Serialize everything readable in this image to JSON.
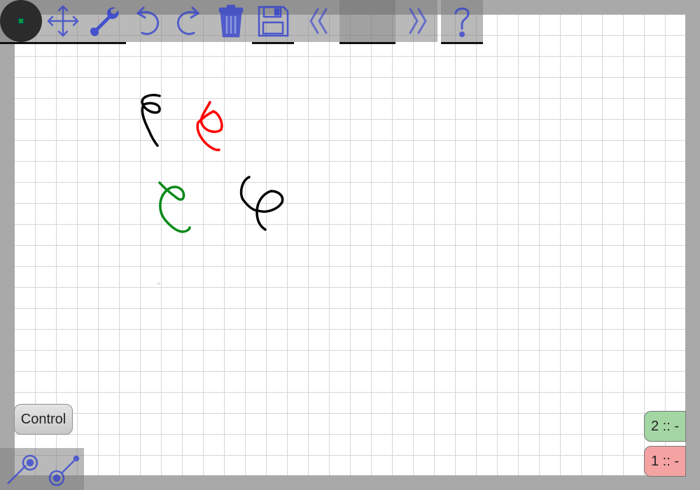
{
  "toolbar": {
    "current_color": "#0a9a3a",
    "tools": [
      {
        "name": "move-icon"
      },
      {
        "name": "wrench-icon"
      },
      {
        "name": "undo-icon"
      },
      {
        "name": "redo-icon"
      },
      {
        "name": "trash-icon"
      },
      {
        "name": "save-icon"
      },
      {
        "name": "previous-page-icon"
      },
      {
        "name": "next-page-icon"
      },
      {
        "name": "help-icon"
      }
    ],
    "page_indicator": ""
  },
  "control_button": {
    "label": "Control"
  },
  "players": [
    {
      "label": "2 :: -",
      "color": "#a4d6a4"
    },
    {
      "label": "1 :: -",
      "color": "#f4a2a2"
    }
  ],
  "bottom_tools": [
    {
      "name": "line-tool-a-icon"
    },
    {
      "name": "line-tool-b-icon"
    }
  ],
  "strokes": [
    {
      "color": "#000000"
    },
    {
      "color": "#ff0000"
    },
    {
      "color": "#0a8a1a"
    },
    {
      "color": "#000000"
    }
  ]
}
